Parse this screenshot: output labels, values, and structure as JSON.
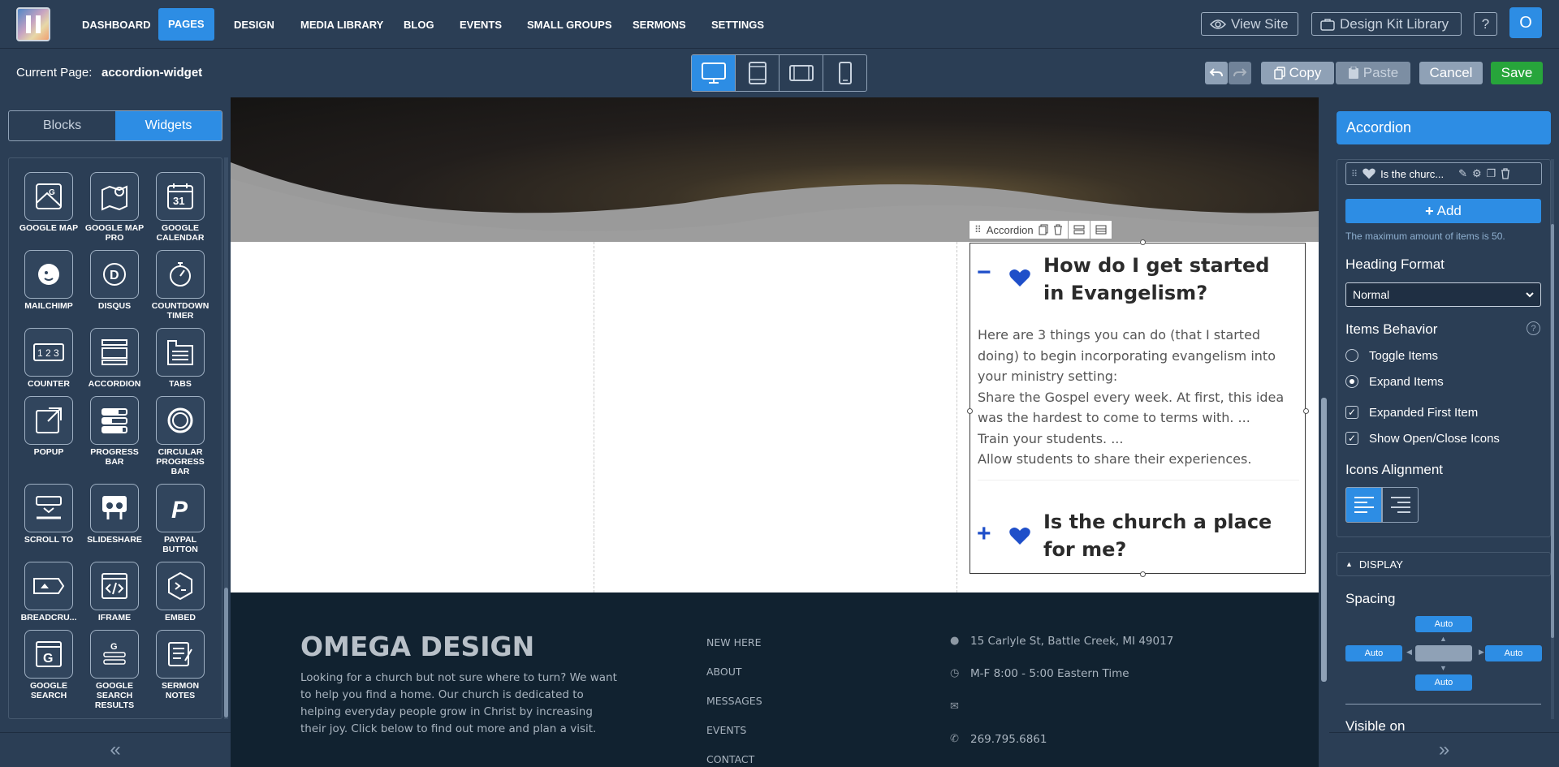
{
  "topbar": {
    "nav": [
      "DASHBOARD",
      "PAGES",
      "DESIGN",
      "MEDIA LIBRARY",
      "BLOG",
      "EVENTS",
      "SMALL GROUPS",
      "SERMONS",
      "SETTINGS"
    ],
    "active_nav": "PAGES",
    "view_site": "View Site",
    "design_kit": "Design Kit Library",
    "help": "?",
    "avatar": "O"
  },
  "subbar": {
    "current_page_label": "Current Page:",
    "current_page_value": "accordion-widget",
    "copy": "Copy",
    "paste": "Paste",
    "cancel": "Cancel",
    "save": "Save"
  },
  "left_panel": {
    "tabs": [
      "Blocks",
      "Widgets"
    ],
    "active_tab": "Widgets",
    "widgets": [
      {
        "label": "GOOGLE MAP",
        "icon": "map-icon"
      },
      {
        "label": "GOOGLE MAP PRO",
        "icon": "map-pin-icon"
      },
      {
        "label": "GOOGLE CALENDAR",
        "icon": "calendar-icon"
      },
      {
        "label": "MAILCHIMP",
        "icon": "mailchimp-icon"
      },
      {
        "label": "DISQUS",
        "icon": "disqus-icon"
      },
      {
        "label": "COUNTDOWN TIMER",
        "icon": "stopwatch-icon"
      },
      {
        "label": "COUNTER",
        "icon": "counter-icon"
      },
      {
        "label": "ACCORDION",
        "icon": "accordion-icon"
      },
      {
        "label": "TABS",
        "icon": "tabs-icon"
      },
      {
        "label": "POPUP",
        "icon": "popup-icon"
      },
      {
        "label": "PROGRESS BAR",
        "icon": "progress-bar-icon"
      },
      {
        "label": "CIRCULAR PROGRESS BAR",
        "icon": "circle-progress-icon"
      },
      {
        "label": "SCROLL TO",
        "icon": "scroll-to-icon"
      },
      {
        "label": "SLIDESHARE",
        "icon": "slideshare-icon"
      },
      {
        "label": "PAYPAL BUTTON",
        "icon": "paypal-icon"
      },
      {
        "label": "BREADCRU...",
        "icon": "breadcrumb-icon"
      },
      {
        "label": "IFRAME",
        "icon": "code-icon"
      },
      {
        "label": "EMBED",
        "icon": "embed-icon"
      },
      {
        "label": "GOOGLE SEARCH",
        "icon": "google-search-icon"
      },
      {
        "label": "GOOGLE SEARCH RESULTS",
        "icon": "search-results-icon"
      },
      {
        "label": "SERMON NOTES",
        "icon": "notes-icon"
      }
    ]
  },
  "canvas": {
    "accordion_toolbar_label": "Accordion",
    "items": [
      {
        "title": "How do I get started in Evangelism?",
        "expanded": true,
        "body": [
          "Here are 3 things you can do (that I started doing) to begin incorporating evangelism into your ministry setting:",
          "Share the Gospel every week. At first, this idea was the hardest to come to terms with. ...",
          "Train your students. ...",
          "Allow students to share their experiences."
        ]
      },
      {
        "title": "Is the church a place for me?",
        "expanded": false
      }
    ],
    "footer": {
      "brand": "OMEGA DESIGN",
      "blurb": "Looking for a church but not sure where to turn? We want to help you find a home. Our church is dedicated to helping everyday people grow in Christ by increasing their joy.  Click below to find out more and plan a visit.",
      "links": [
        "NEW HERE",
        "ABOUT",
        "MESSAGES",
        "EVENTS",
        "CONTACT"
      ],
      "address": "15 Carlyle St, Battle Creek, MI 49017",
      "hours": "M-F 8:00 - 5:00 Eastern Time",
      "phone": "269.795.6861"
    }
  },
  "right_panel": {
    "title": "Accordion",
    "item_label": "Is the churc...",
    "add": "Add",
    "max_note": "The maximum amount of items is 50.",
    "heading_format_label": "Heading Format",
    "heading_format_value": "Normal",
    "items_behavior_label": "Items Behavior",
    "toggle_items": "Toggle Items",
    "expand_items": "Expand Items",
    "behavior_selected": "Expand Items",
    "expanded_first": "Expanded First Item",
    "expanded_first_checked": true,
    "show_icons": "Show Open/Close Icons",
    "show_icons_checked": true,
    "icons_alignment_label": "Icons Alignment",
    "icons_alignment": "left",
    "display_label": "DISPLAY",
    "spacing_label": "Spacing",
    "spacing": {
      "top": "Auto",
      "left": "Auto",
      "right": "Auto",
      "bottom": "Auto"
    },
    "visible_on_label": "Visible on"
  },
  "colors": {
    "accent": "#2d8de4",
    "panel": "#2b3e55",
    "save": "#27a53b",
    "heart": "#1f4fc9",
    "footer": "#112230"
  }
}
